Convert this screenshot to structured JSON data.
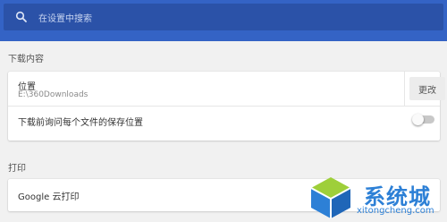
{
  "search": {
    "placeholder": "在设置中搜索"
  },
  "downloads": {
    "heading": "下载内容",
    "location_title": "位置",
    "location_path": "E:\\360Downloads",
    "change_button": "更改",
    "ask_label": "下载前询问每个文件的保存位置",
    "ask_enabled": false
  },
  "printing": {
    "heading": "打印",
    "google_cloud_print": "Google 云打印"
  },
  "watermark": {
    "brand": "系统城",
    "domain": "xitongcheng.com"
  },
  "colors": {
    "header": "#3463c5",
    "searchbox": "#2b52a8",
    "background": "#f1f1f1",
    "watermark": "#2d80d6"
  }
}
